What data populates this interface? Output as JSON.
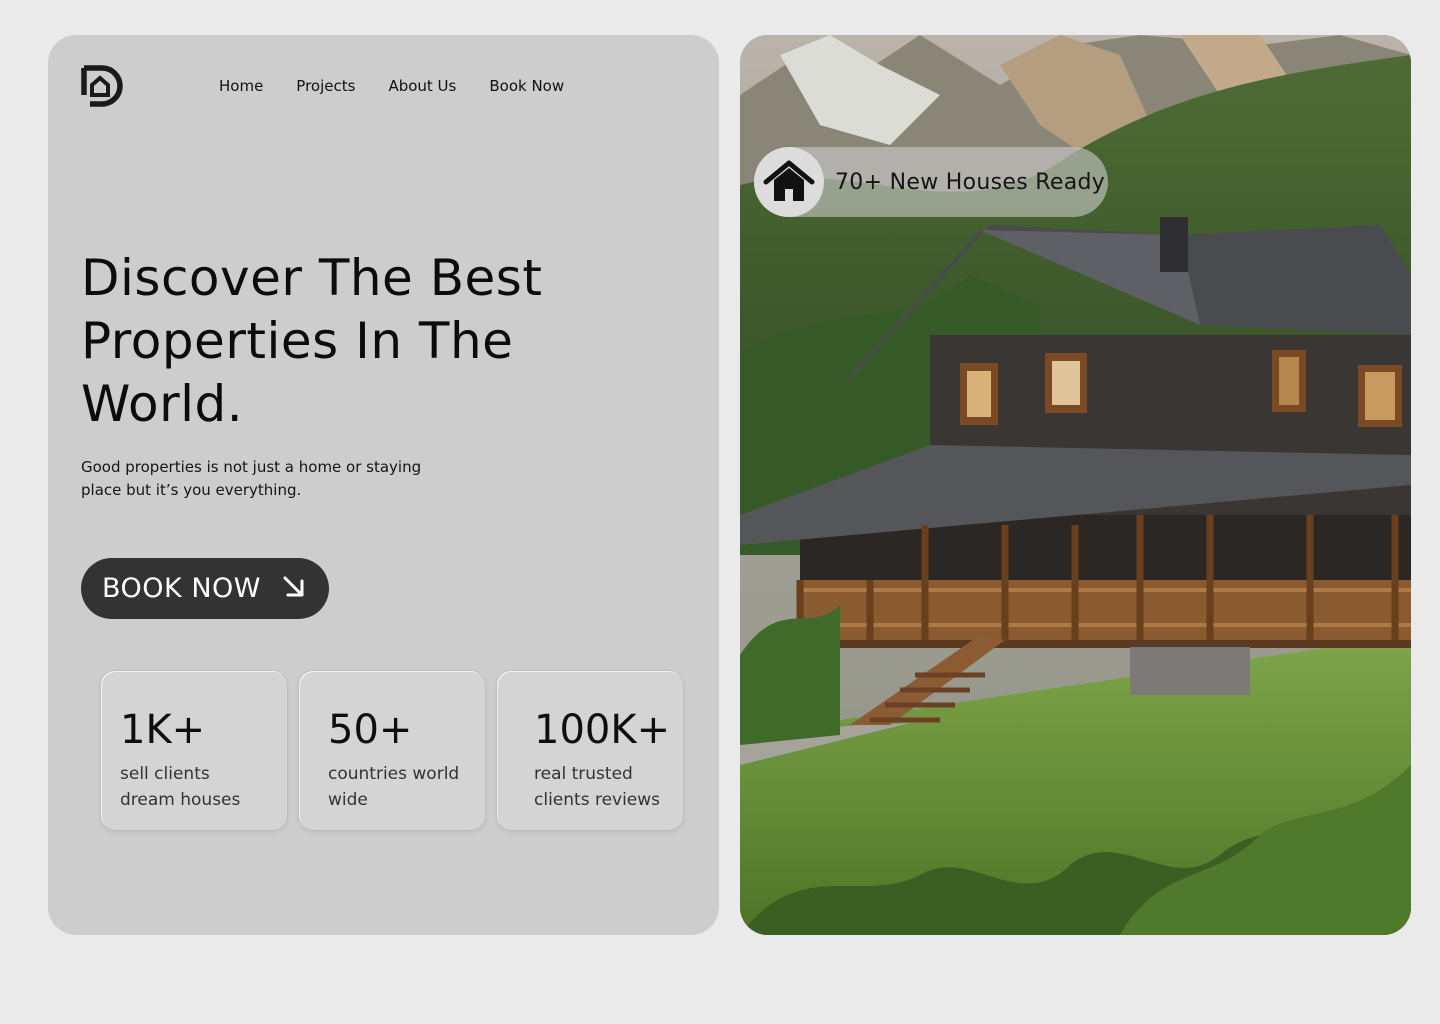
{
  "nav": {
    "items": [
      {
        "label": "Home"
      },
      {
        "label": "Projects"
      },
      {
        "label": "About Us"
      },
      {
        "label": "Book Now"
      }
    ]
  },
  "hero": {
    "headline_line1": "Discover The Best",
    "headline_line2": "Properties In The",
    "headline_line3": "World.",
    "subtitle_line1": "Good properties is not just a home or staying",
    "subtitle_line2": "place but it’s you everything.",
    "cta_label": "BOOK NOW"
  },
  "stats": [
    {
      "value": "1K+",
      "label_line1": "sell clients",
      "label_line2": "dream houses"
    },
    {
      "value": "50+",
      "label_line1": "countries world",
      "label_line2": "wide"
    },
    {
      "value": "100K+",
      "label_line1": "real trusted",
      "label_line2": "clients reviews"
    }
  ],
  "badge": {
    "text": "70+ New Houses Ready",
    "icon": "house-icon"
  },
  "colors": {
    "page_bg": "#eaeaea",
    "card_bg": "#cdcdcd",
    "button_bg": "#333333",
    "button_text": "#ffffff"
  }
}
